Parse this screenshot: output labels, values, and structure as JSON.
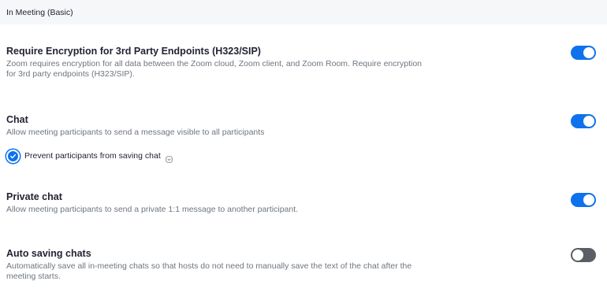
{
  "section": {
    "title": "In Meeting (Basic)"
  },
  "settings": [
    {
      "title": "Require Encryption for 3rd Party Endpoints (H323/SIP)",
      "desc_line1": "Zoom requires encryption for all data between the Zoom cloud, Zoom client, and Zoom Room. Require encryption",
      "desc_line2": "for 3rd party endpoints (H323/SIP).",
      "enabled": true
    },
    {
      "title": "Chat",
      "desc_line1": "Allow meeting participants to send a message visible to all participants",
      "enabled": true,
      "sub_option": {
        "label": "Prevent participants from saving chat",
        "checked": true,
        "icon": "info-icon"
      }
    },
    {
      "title": "Private chat",
      "desc_line1": "Allow meeting participants to send a private 1:1 message to another participant.",
      "enabled": true
    },
    {
      "title": "Auto saving chats",
      "desc_line1": "Automatically save all in-meeting chats so that hosts do not need to manually save the text of the chat after the",
      "desc_line2": "meeting starts.",
      "enabled": false
    }
  ],
  "colors": {
    "toggle_on": "#0e72ed",
    "toggle_off": "#5c5e66",
    "header_bg": "#f6f7f9"
  }
}
